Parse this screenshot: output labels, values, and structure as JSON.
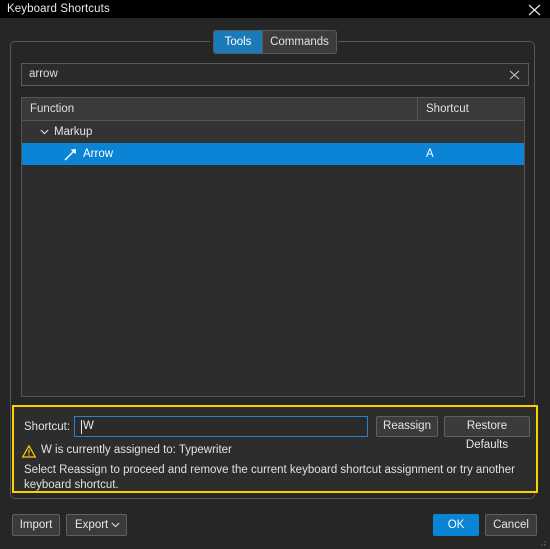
{
  "window": {
    "title": "Keyboard Shortcuts",
    "close_icon": "close-icon"
  },
  "tabs": [
    {
      "label": "Tools",
      "active": true
    },
    {
      "label": "Commands",
      "active": false
    }
  ],
  "search": {
    "value": "arrow",
    "placeholder": "",
    "clear_icon": "close-icon"
  },
  "table": {
    "columns": [
      "Function",
      "Shortcut"
    ],
    "rows": [
      {
        "type": "group",
        "label": "Markup",
        "expanded": true,
        "chevron_icon": "chevron-down-icon"
      },
      {
        "type": "item",
        "label": "Arrow",
        "shortcut": "A",
        "icon": "arrow-northeast-icon",
        "selected": true
      }
    ]
  },
  "shortcut_panel": {
    "label": "Shortcut:",
    "value": "W",
    "reassign_label": "Reassign",
    "restore_label": "Restore Defaults",
    "warning_icon": "warning-triangle-icon",
    "warning_text": "W is currently assigned to: Typewriter",
    "hint_text": "Select Reassign to proceed and remove the current keyboard shortcut assignment or try another keyboard shortcut."
  },
  "footer": {
    "import_label": "Import",
    "export_label": "Export",
    "export_chevron_icon": "chevron-down-icon",
    "ok_label": "OK",
    "cancel_label": "Cancel"
  },
  "colors": {
    "accent_blue": "#0b84d6",
    "tab_active_blue": "#1b7ab8",
    "warning_yellow": "#ffd000",
    "dialog_bg": "#262626",
    "list_bg": "#2d2d2d",
    "header_bg": "#3a3a3a"
  }
}
